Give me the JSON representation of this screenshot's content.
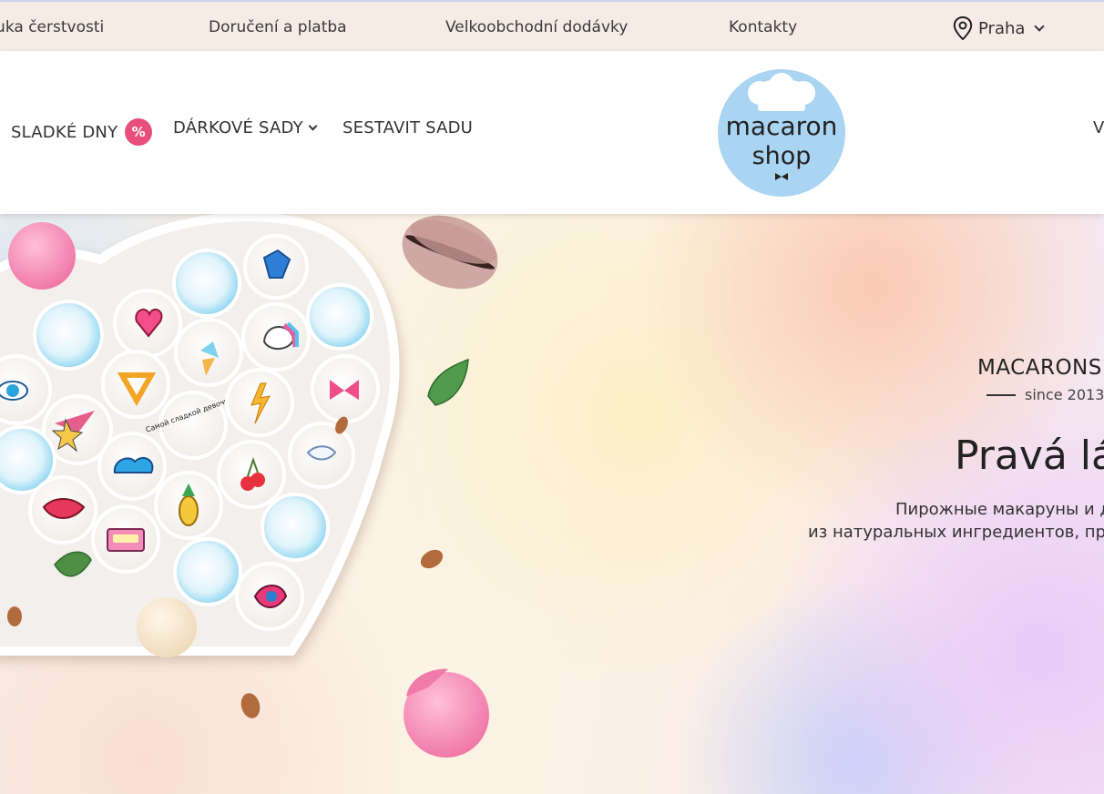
{
  "topbar": {
    "links": [
      "Záruka čerstvosti",
      "Doručení a platba",
      "Velkoobchodní dodávky",
      "Kontakty"
    ],
    "city": "Praha"
  },
  "nav": {
    "sweet_days": "SLADKÉ DNY",
    "sweet_days_badge": "%",
    "gift_sets": "DÁRKOVÉ SADY",
    "build_set": "SESTAVIT SADU",
    "right_cut": "V"
  },
  "logo": {
    "line1": "macaron",
    "line2": "shop"
  },
  "hero": {
    "eyebrow": "MACARONS",
    "since": "since 2013",
    "headline": "Pravá lá",
    "sub_line1": "Пирожные макаруны и д",
    "sub_line2": "из натуральных ингредиентов, пр",
    "macaron_text": "Самой сладкой девочке"
  },
  "colors": {
    "topbar_bg": "#f7ebe6",
    "badge": "#e84f7c",
    "logo_bg": "#a9d4f2"
  }
}
